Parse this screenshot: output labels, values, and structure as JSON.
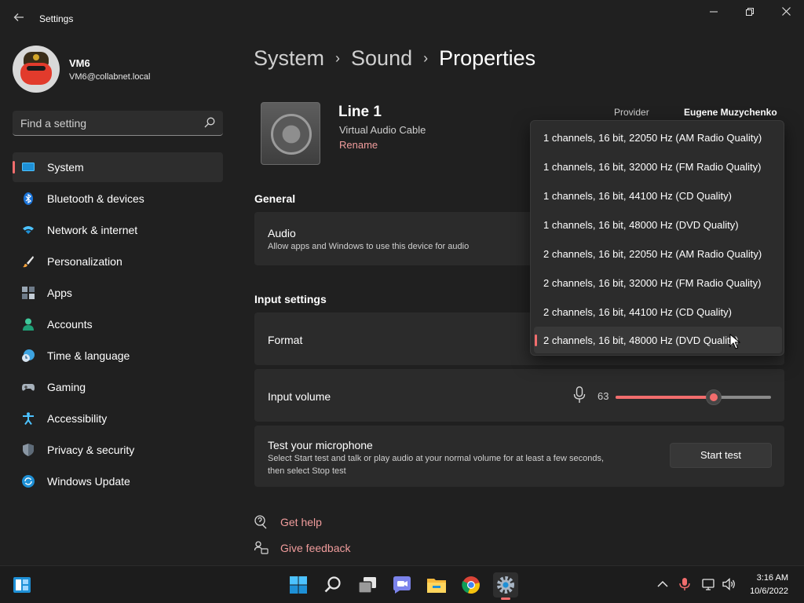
{
  "window": {
    "title": "Settings",
    "back_icon": "arrow-left-icon",
    "controls": [
      "minimize-icon",
      "restore-icon",
      "close-icon"
    ]
  },
  "profile": {
    "name": "VM6",
    "email": "VM6@collabnet.local"
  },
  "search": {
    "placeholder": "Find a setting",
    "value": ""
  },
  "sidebar": {
    "items": [
      {
        "label": "System",
        "icon": "monitor-icon",
        "active": true
      },
      {
        "label": "Bluetooth & devices",
        "icon": "bluetooth-icon"
      },
      {
        "label": "Network & internet",
        "icon": "wifi-icon"
      },
      {
        "label": "Personalization",
        "icon": "brush-icon"
      },
      {
        "label": "Apps",
        "icon": "apps-icon"
      },
      {
        "label": "Accounts",
        "icon": "person-icon"
      },
      {
        "label": "Time & language",
        "icon": "clock-globe-icon"
      },
      {
        "label": "Gaming",
        "icon": "gamepad-icon"
      },
      {
        "label": "Accessibility",
        "icon": "accessibility-icon"
      },
      {
        "label": "Privacy & security",
        "icon": "shield-icon"
      },
      {
        "label": "Windows Update",
        "icon": "update-icon"
      }
    ]
  },
  "breadcrumb": {
    "items": [
      "System",
      "Sound",
      "Properties"
    ]
  },
  "device": {
    "name": "Line 1",
    "subtitle": "Virtual Audio Cable",
    "rename_label": "Rename",
    "provider_label": "Provider",
    "provider_value": "Eugene Muzychenko"
  },
  "general": {
    "title": "General",
    "audio_title": "Audio",
    "audio_desc": "Allow apps and Windows to use this device for audio"
  },
  "input_settings": {
    "title": "Input settings",
    "format_label": "Format",
    "volume_label": "Input volume",
    "volume_value": "63",
    "volume_fraction": 0.63
  },
  "test": {
    "title": "Test your microphone",
    "desc_line1": "Select Start test and talk or play audio at your normal volume for at least a few seconds,",
    "desc_line2": "then select Stop test",
    "button_label": "Start test"
  },
  "links": {
    "help": "Get help",
    "feedback": "Give feedback"
  },
  "format_dropdown": {
    "options": [
      "1 channels, 16 bit, 22050 Hz (AM Radio Quality)",
      "1 channels, 16 bit, 32000 Hz (FM Radio Quality)",
      "1 channels, 16 bit, 44100 Hz (CD Quality)",
      "1 channels, 16 bit, 48000 Hz (DVD Quality)",
      "2 channels, 16 bit, 22050 Hz (AM Radio Quality)",
      "2 channels, 16 bit, 32000 Hz (FM Radio Quality)",
      "2 channels, 16 bit, 44100 Hz (CD Quality)",
      "2 channels, 16 bit, 48000 Hz (DVD Quality)"
    ],
    "selected_index": 7
  },
  "taskbar": {
    "apps": [
      "widgets-icon",
      "start-icon",
      "search-icon",
      "task-view-icon",
      "chat-icon",
      "file-explorer-icon",
      "chrome-icon",
      "settings-icon"
    ],
    "tray": [
      "chevron-up-icon",
      "microphone-icon",
      "network-icon",
      "volume-icon"
    ],
    "time": "3:16 AM",
    "date": "10/6/2022"
  },
  "colors": {
    "accent": "#f26d6d",
    "link": "#f09c9c",
    "background": "#202020",
    "card": "#2b2b2b"
  }
}
